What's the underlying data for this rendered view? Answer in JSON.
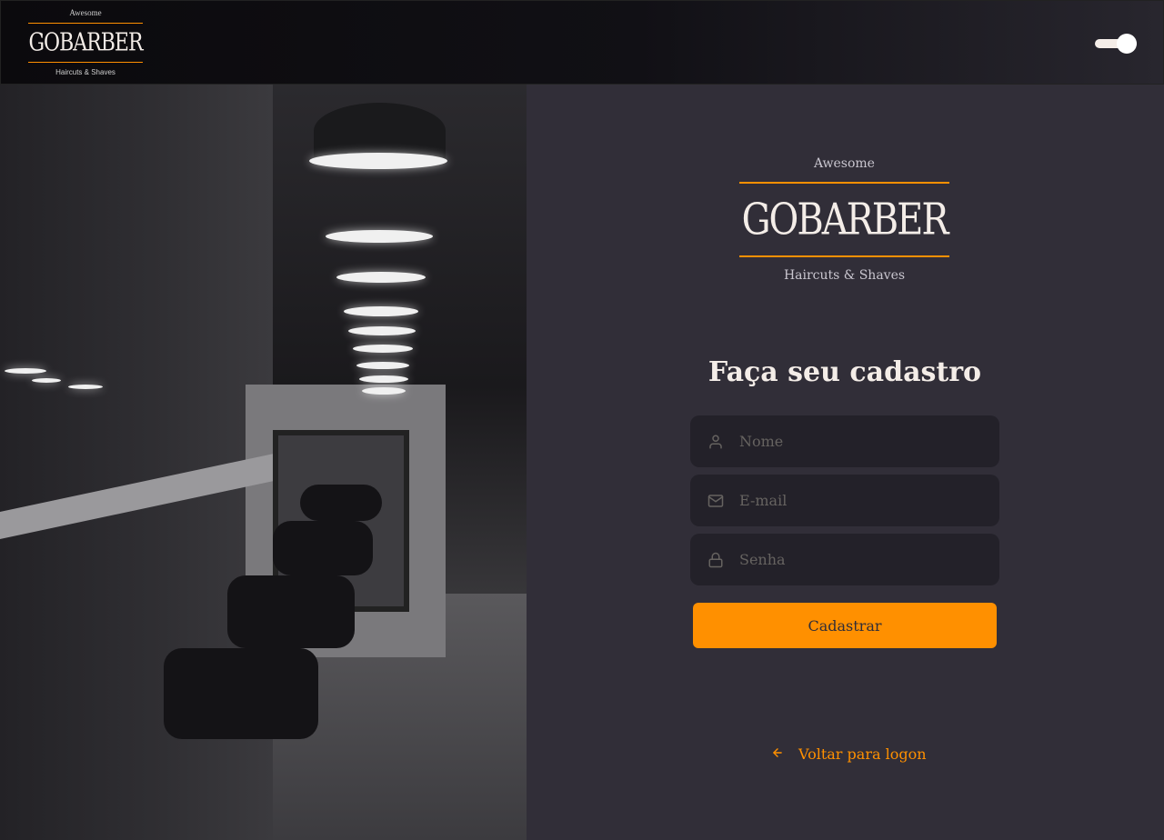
{
  "header": {
    "logo": {
      "top": "Awesome",
      "brand": "GOBARBER",
      "bottom": "Haircuts & Shaves"
    },
    "theme_toggle_on": true
  },
  "main": {
    "logo": {
      "top": "Awesome",
      "brand": "GOBARBER",
      "bottom": "Haircuts & Shaves"
    },
    "title": "Faça seu cadastro",
    "fields": [
      {
        "icon": "user-icon",
        "placeholder": "Nome",
        "value": ""
      },
      {
        "icon": "mail-icon",
        "placeholder": "E-mail",
        "value": ""
      },
      {
        "icon": "lock-icon",
        "placeholder": "Senha",
        "value": ""
      }
    ],
    "submit_label": "Cadastrar",
    "back_link": {
      "icon": "arrow-left-icon",
      "label": "Voltar para logon"
    }
  },
  "colors": {
    "accent": "#ff9000",
    "background": "#312e38",
    "input_bg": "#232129",
    "text": "#f4ede8",
    "placeholder": "#666360"
  },
  "image": {
    "icon": "barbershop-photo"
  }
}
